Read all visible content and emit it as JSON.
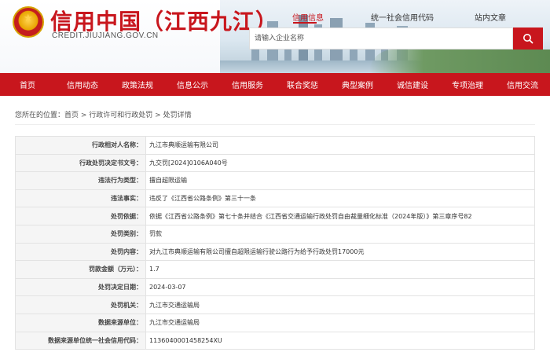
{
  "header": {
    "logo_title": "信用中国（江西九江）",
    "logo_url": "CREDIT.JIUJIANG.GOV.CN",
    "search_tabs": [
      {
        "label": "信用信息"
      },
      {
        "label": "统一社会信用代码"
      },
      {
        "label": "站内文章"
      }
    ],
    "search_placeholder": "请输入企业名称"
  },
  "nav": {
    "items": [
      {
        "label": "首页"
      },
      {
        "label": "信用动态"
      },
      {
        "label": "政策法规"
      },
      {
        "label": "信息公示"
      },
      {
        "label": "信用服务"
      },
      {
        "label": "联合奖惩"
      },
      {
        "label": "典型案例"
      },
      {
        "label": "诚信建设"
      },
      {
        "label": "专项治理"
      },
      {
        "label": "信用交流"
      }
    ]
  },
  "breadcrumb": {
    "prefix": "您所在的位置：",
    "home": "首页",
    "sep1": " > ",
    "section": "行政许可和行政处罚",
    "sep2": " > ",
    "current": "处罚详情"
  },
  "detail_rows": [
    {
      "key": "行政相对人名称：",
      "value": "九江市典顺运输有限公司"
    },
    {
      "key": "行政处罚决定书文号：",
      "value": "九交罚[2024]0106A040号"
    },
    {
      "key": "违法行为类型：",
      "value": "擅自超限运输"
    },
    {
      "key": "违法事实：",
      "value": "违反了《江西省公路条例》第三十一条"
    },
    {
      "key": "处罚依据：",
      "value": "依据《江西省公路条例》第七十条并结合《江西省交通运输行政处罚自由裁量细化标准（2024年版）》第三章序号82"
    },
    {
      "key": "处罚类别：",
      "value": "罚款"
    },
    {
      "key": "处罚内容：",
      "value": "对九江市典顺运输有限公司擅自超限运输行驶公路行为给予行政处罚17000元"
    },
    {
      "key": "罚款金额（万元）：",
      "value": "1.7"
    },
    {
      "key": "处罚决定日期：",
      "value": "2024-03-07"
    },
    {
      "key": "处罚机关：",
      "value": "九江市交通运输局"
    },
    {
      "key": "数据来源单位：",
      "value": "九江市交通运输局"
    },
    {
      "key": "数据来源单位统一社会信用代码：",
      "value": "113604000145825​4XU"
    }
  ],
  "colors": {
    "brand_red": "#c8161d",
    "nav_bg": "#c8161d"
  }
}
